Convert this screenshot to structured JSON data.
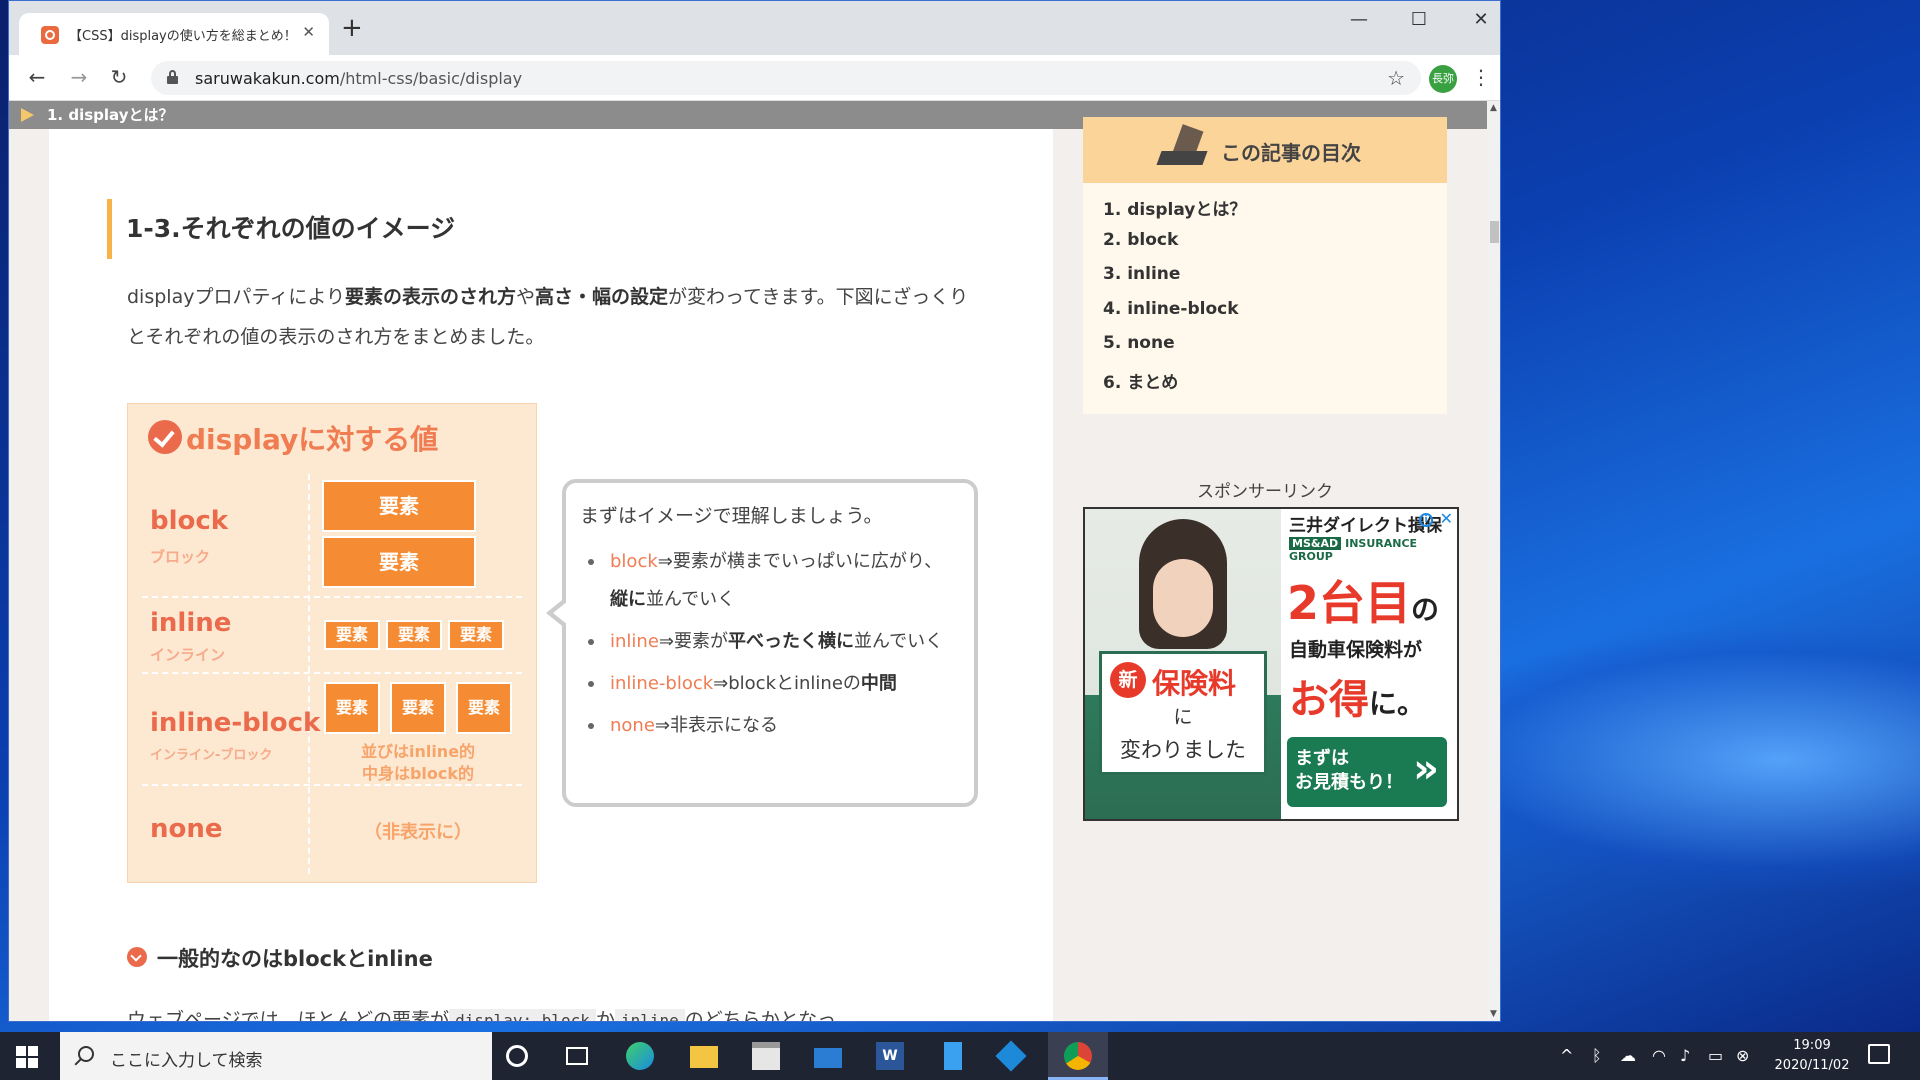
{
  "browser": {
    "tab_title": "【CSS】displayの使い方を総まとめ！",
    "tab_close": "✕",
    "new_tab": "+",
    "url_host": "saruwakakun.com",
    "url_path": "/html-css/basic/display",
    "profile_label": "長弥",
    "window_controls": {
      "minimize": "—",
      "maximize": "☐",
      "close": "✕"
    },
    "nav": {
      "back": "←",
      "forward": "→",
      "reload": "↻"
    },
    "star": "☆",
    "menu": "⋮"
  },
  "sticky_header": "1. displayとは？",
  "article": {
    "heading": "1-3.それぞれの値のイメージ",
    "intro_parts": [
      "displayプロパティにより",
      "要素の表示のされ方",
      "や",
      "高さ・幅の設定",
      "が変わってきます。下図にざっくりとそれぞれの値の表示のされ方をまとめました。"
    ],
    "figure": {
      "title": "displayに対する値",
      "rows": [
        {
          "label": "block",
          "sub": "ブロック"
        },
        {
          "label": "inline",
          "sub": "インライン"
        },
        {
          "label": "inline-block",
          "sub": "インライン-ブロック"
        },
        {
          "label": "none",
          "sub": ""
        }
      ],
      "element_text": "要素",
      "inline_block_note_1": "並びはinline的",
      "inline_block_note_2": "中身はblock的",
      "none_note": "（非表示に）"
    },
    "callout": {
      "lead": "まずはイメージで理解しましょう。",
      "items": [
        {
          "kw": "block",
          "t1": "⇒要素が横までいっぱいに広がり、",
          "b": "縦に",
          "t2": "並んでいく"
        },
        {
          "kw": "inline",
          "t1": "⇒要素が",
          "b": "平べったく横に",
          "t2": "並んでいく"
        },
        {
          "kw": "inline-block",
          "t1": "⇒blockとinlineの",
          "b": "中間",
          "t2": ""
        },
        {
          "kw": "none",
          "t1": "⇒非表示になる",
          "b": "",
          "t2": ""
        }
      ]
    },
    "subheading": "一般的なのはblockとinline",
    "cutoff_parts": [
      "ウェブページでは、ほとんどの要素が",
      "display: block",
      "か",
      "inline",
      "のどちらかとなっ"
    ]
  },
  "toc": {
    "title": "この記事の目次",
    "items": [
      "1. displayとは？",
      "2. block",
      "3. inline",
      "4. inline-block",
      "5. none",
      "6. まとめ"
    ]
  },
  "sponsor_label": "スポンサーリンク",
  "ad": {
    "brand": "三井ダイレクト損保",
    "brand_sub_tag": "MS&AD",
    "brand_sub": "INSURANCE GROUP",
    "headline_num": "2台目",
    "headline_no": "の",
    "line2": "自動車保険料が",
    "otoku": "お得",
    "otoku_suffix": "に。",
    "sign_new": "新",
    "sign_t1": "保険料",
    "sign_t2": "に",
    "sign_t3": "変わりました",
    "cta": "まずは\nお見積もり！",
    "cta_arrow": "»",
    "info": "i",
    "close": "✕"
  },
  "taskbar": {
    "search_placeholder": "ここに入力して検索",
    "time": "19:09",
    "date": "2020/11/02"
  }
}
